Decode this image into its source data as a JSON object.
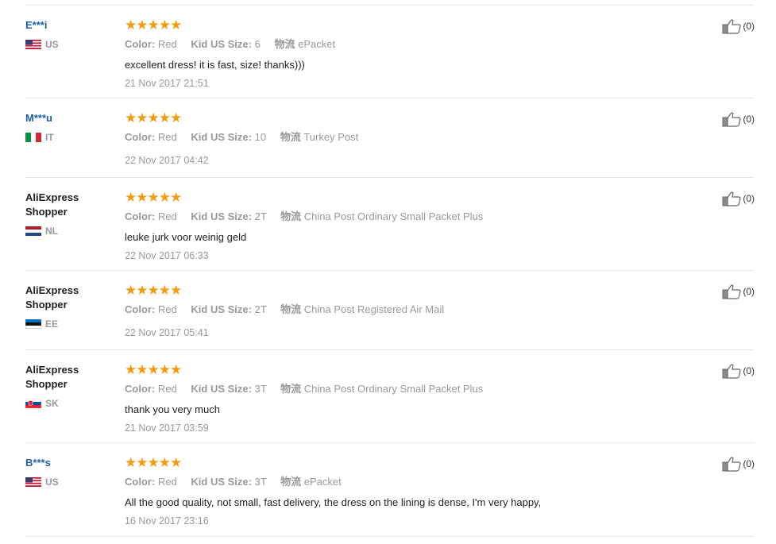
{
  "labels": {
    "color": "Color:",
    "size": "Kid US Size:",
    "logistics": "物流"
  },
  "reviews": [
    {
      "name": "E***i",
      "country": "US",
      "color": "Red",
      "size": "6",
      "shipping": "ePacket",
      "text": "excellent dress! it is fast, size! thanks)))",
      "time": "21 Nov 2017 21:51",
      "useful": "(0)"
    },
    {
      "name": "M***u",
      "country": "IT",
      "color": "Red",
      "size": "10",
      "shipping": "Turkey Post",
      "text": "",
      "time": "22 Nov 2017 04:42",
      "useful": "(0)"
    },
    {
      "name": "AliExpress Shopper",
      "country": "NL",
      "color": "Red",
      "size": "2T",
      "shipping": "China Post Ordinary Small Packet Plus",
      "text": "leuke jurk voor weinig geld",
      "time": "22 Nov 2017 06:33",
      "useful": "(0)"
    },
    {
      "name": "AliExpress Shopper",
      "country": "EE",
      "color": "Red",
      "size": "2T",
      "shipping": "China Post Registered Air Mail",
      "text": "",
      "time": "22 Nov 2017 05:41",
      "useful": "(0)"
    },
    {
      "name": "AliExpress Shopper",
      "country": "SK",
      "color": "Red",
      "size": "3T",
      "shipping": "China Post Ordinary Small Packet Plus",
      "text": "thank you very much",
      "time": "21 Nov 2017 03:59",
      "useful": "(0)"
    },
    {
      "name": "B***s",
      "country": "US",
      "color": "Red",
      "size": "3T",
      "shipping": "ePacket",
      "text": "All the good quality, not small, fast delivery, the dress on the lining is dense, I'm very happy,",
      "time": "16 Nov 2017 23:16",
      "useful": "(0)"
    }
  ],
  "stars": "★★★★★",
  "colors": {
    "star": "#f39c12",
    "masked_name": "#1e5ea8",
    "muted": "#999999"
  }
}
